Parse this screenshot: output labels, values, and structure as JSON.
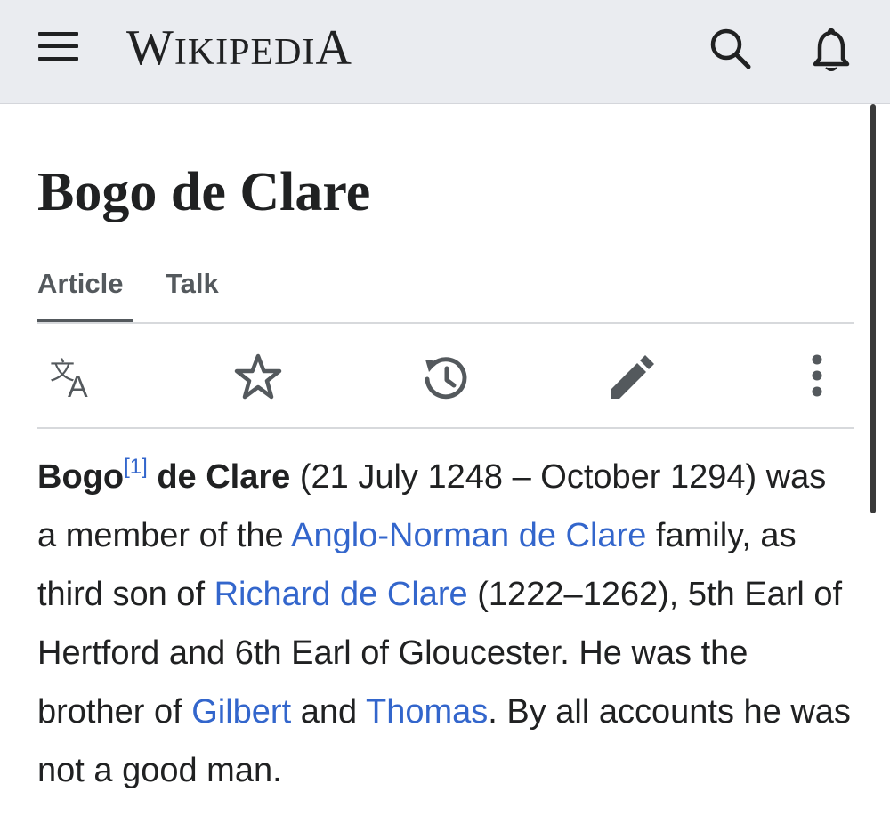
{
  "header": {
    "wordmark": {
      "w": "W",
      "rest1": "IKIPEDI",
      "a": "A"
    }
  },
  "title": "Bogo de Clare",
  "tabs": [
    {
      "label": "Article",
      "active": true
    },
    {
      "label": "Talk",
      "active": false
    }
  ],
  "actions": [
    "language-icon",
    "watch-star-icon",
    "history-icon",
    "edit-pencil-icon",
    "more-options-icon"
  ],
  "body": {
    "name_first": "Bogo",
    "ref": "[1]",
    "name_rest": "de Clare",
    "t1": "(21 July 1248 – October 1294) was a member of the",
    "link_anglo": "Anglo-Norman de Clare",
    "t2": "family, as third son of",
    "link_richard": "Richard de Clare",
    "t3": "(1222–1262), 5th Earl of Hertford and 6th Earl of Gloucester. He was the brother of",
    "link_gilbert": "Gilbert",
    "t4": "and",
    "link_thomas": "Thomas",
    "t5": ". By all accounts he was not a good man."
  },
  "colors": {
    "link": "#3366cc",
    "header_bg": "#eaecf0",
    "text": "#202122"
  }
}
